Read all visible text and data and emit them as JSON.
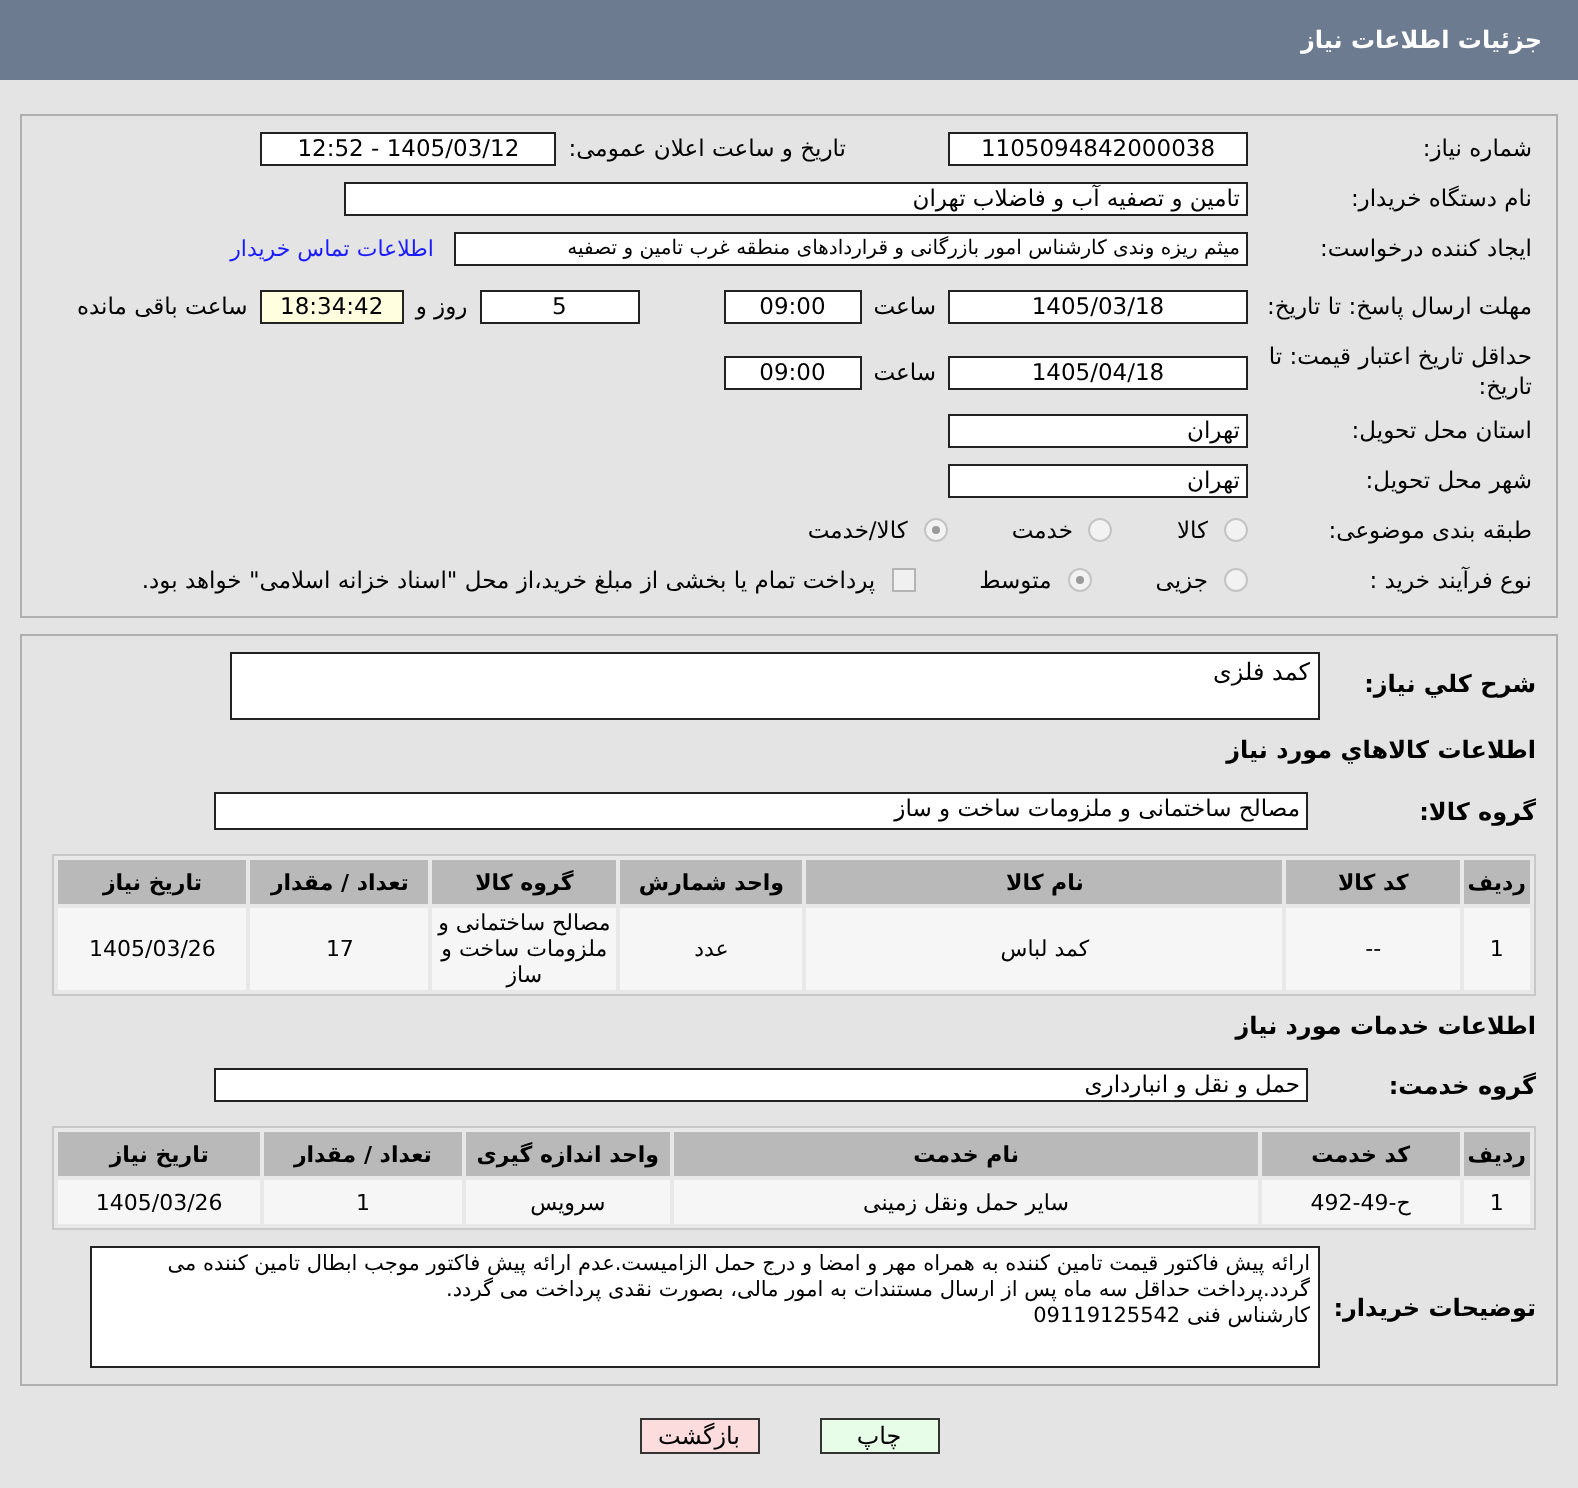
{
  "header": {
    "title": "جزئیات اطلاعات نیاز"
  },
  "need_info": {
    "need_number": {
      "label": "شماره نیاز:",
      "value": "1105094842000038"
    },
    "announce": {
      "label": "تاریخ و ساعت اعلان عمومی:",
      "value": "1405/03/12 - 12:52"
    },
    "buyer": {
      "label": "نام دستگاه خریدار:",
      "value": "تامین و تصفیه آب و فاضلاب تهران"
    },
    "creator": {
      "label": "ایجاد کننده درخواست:",
      "value": "میثم ریزه وندی کارشناس امور بازرگانی و قراردادهای منطقه غرب تامین و تصفیه",
      "link": "اطلاعات تماس خریدار"
    },
    "reply_deadline": {
      "label": "مهلت ارسال پاسخ: تا تاریخ:",
      "date": "1405/03/18",
      "time_label": "ساعت",
      "time": "09:00",
      "days": "5",
      "days_label": "روز و",
      "remaining": "18:34:42",
      "remaining_label": "ساعت باقی مانده"
    },
    "price_validity": {
      "label": "حداقل تاریخ اعتبار قیمت: تا تاریخ:",
      "date": "1405/04/18",
      "time_label": "ساعت",
      "time": "09:00"
    },
    "province": {
      "label": "استان محل تحویل:",
      "value": "تهران"
    },
    "city": {
      "label": "شهر محل تحویل:",
      "value": "تهران"
    },
    "category": {
      "label": "طبقه بندی موضوعی:",
      "options": [
        {
          "label": "کالا",
          "selected": false
        },
        {
          "label": "خدمت",
          "selected": false
        },
        {
          "label": "کالا/خدمت",
          "selected": true
        }
      ]
    },
    "process": {
      "label": "نوع فرآیند خرید :",
      "options": [
        {
          "label": "جزیی",
          "selected": false
        },
        {
          "label": "متوسط",
          "selected": true
        }
      ],
      "treasury": {
        "label": "پرداخت تمام یا بخشی از مبلغ خرید،از محل \"اسناد خزانه اسلامی\" خواهد بود.",
        "checked": false
      }
    }
  },
  "details": {
    "description": {
      "label": "شرح کلي نياز:",
      "value": "کمد فلزی"
    },
    "goods_heading": "اطلاعات کالاهاي مورد نياز",
    "goods_group": {
      "label": "گروه کالا:",
      "value": "مصالح ساختمانی و ملزومات ساخت و ساز"
    },
    "goods_table": {
      "columns": [
        "ردیف",
        "کد کالا",
        "نام کالا",
        "واحد شمارش",
        "گروه کالا",
        "تعداد / مقدار",
        "تاریخ نیاز"
      ],
      "rows": [
        [
          "1",
          "--",
          "کمد لباس",
          "عدد",
          "مصالح ساختمانی و ملزومات ساخت و ساز",
          "17",
          "1405/03/26"
        ]
      ]
    },
    "services_heading": "اطلاعات خدمات مورد نياز",
    "service_group": {
      "label": "گروه خدمت:",
      "value": "حمل و نقل و انبارداری"
    },
    "services_table": {
      "columns": [
        "ردیف",
        "کد خدمت",
        "نام خدمت",
        "واحد اندازه گیری",
        "تعداد / مقدار",
        "تاریخ نیاز"
      ],
      "rows": [
        [
          "1",
          "ح-49-492",
          "سایر حمل ونقل زمینی",
          "سرویس",
          "1",
          "1405/03/26"
        ]
      ]
    },
    "notes": {
      "label": "توضیحات خریدار:",
      "value": "ارائه پیش فاکتور قیمت تامین کننده به همراه مهر و امضا و درج حمل الزامیست.عدم ارائه پیش فاکتور موجب ابطال تامین کننده می گردد.پرداخت حداقل سه ماه پس از ارسال مستندات به امور مالی، بصورت نقدی پرداخت می گردد.\nکارشناس فنی 09119125542"
    }
  },
  "buttons": [
    {
      "kind": "print",
      "label": "چاپ"
    },
    {
      "kind": "back",
      "label": "بازگشت"
    }
  ]
}
